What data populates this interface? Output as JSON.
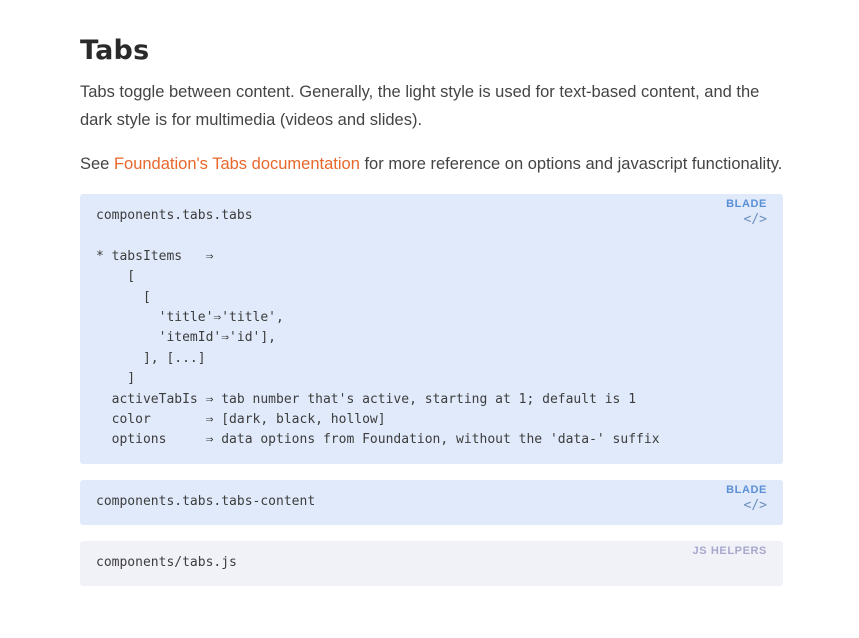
{
  "section": {
    "title": "Tabs",
    "intro": "Tabs toggle between content. Generally, the light style is used for text-based content, and the dark style is for multimedia (videos and slides).",
    "see_prefix": "See ",
    "link_text": "Foundation's Tabs documentation",
    "see_suffix": " for more reference on options and javascript functionality."
  },
  "blocks": [
    {
      "badge": "BLADE",
      "icon": "</>",
      "lines": [
        "components.tabs.tabs",
        "",
        "* tabsItems   ⇒",
        "    [",
        "      [",
        "        'title'⇒'title',",
        "        'itemId'⇒'id'],",
        "      ], [...]",
        "    ]",
        "  activeTabIs ⇒ tab number that's active, starting at 1; default is 1",
        "  color       ⇒ [dark, black, hollow]",
        "  options     ⇒ data options from Foundation, without the 'data-' suffix"
      ]
    },
    {
      "badge": "BLADE",
      "icon": "</>",
      "lines": [
        "components.tabs.tabs-content"
      ]
    },
    {
      "badge": "JS HELPERS",
      "lines": [
        "components/tabs.js"
      ]
    }
  ]
}
